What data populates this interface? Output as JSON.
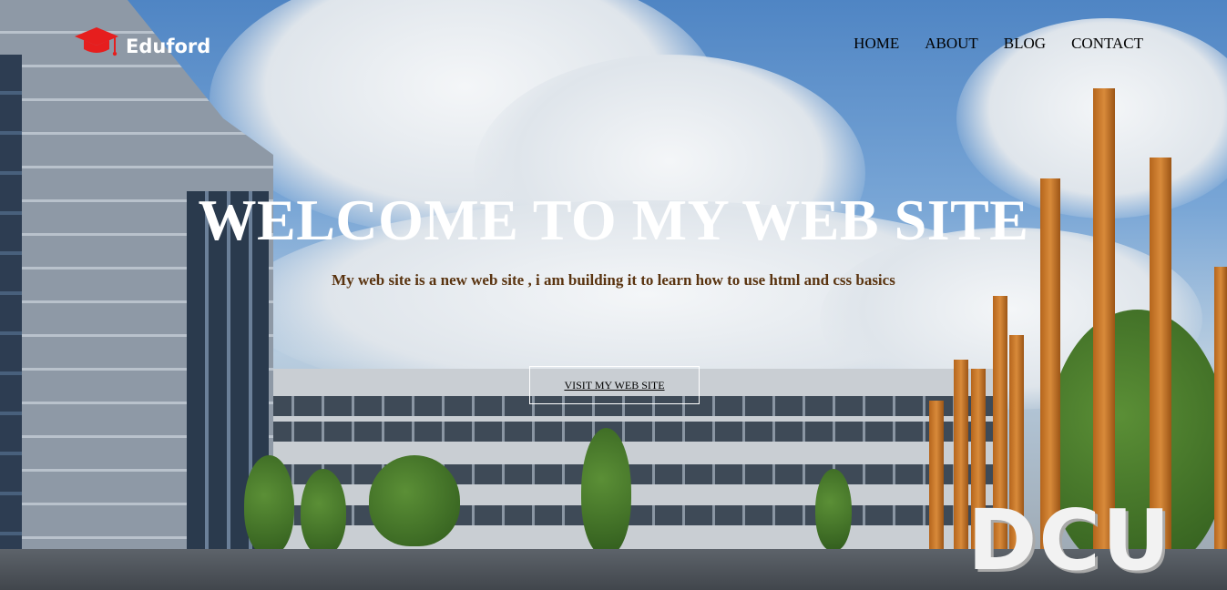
{
  "brand": {
    "name": "Eduford",
    "icon": "graduation-cap-icon",
    "icon_color": "#e61e1e"
  },
  "nav": {
    "items": [
      {
        "label": "HOME"
      },
      {
        "label": "ABOUT"
      },
      {
        "label": "BLOG"
      },
      {
        "label": "CONTACT"
      }
    ]
  },
  "hero": {
    "title": "WELCOME TO MY WEB SITE",
    "subtitle": "My web site is a new web site , i am building it to learn how to use html and css basics",
    "button_label": "VISIT MY WEB SITE",
    "background_sign": "DCU"
  },
  "colors": {
    "title": "#ffffff",
    "subtitle": "#5a3410",
    "nav_text": "#000000",
    "button_border": "#ffffff"
  }
}
